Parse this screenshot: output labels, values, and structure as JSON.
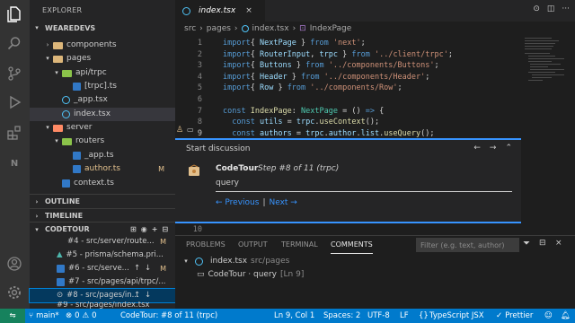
{
  "explorer": {
    "title": "EXPLORER",
    "workspace": "WEAREDEVS",
    "tree": [
      {
        "label": "components",
        "badge": ""
      },
      {
        "label": "pages",
        "badge": ""
      },
      {
        "label": "api/trpc",
        "badge": ""
      },
      {
        "label": "[trpc].ts",
        "badge": ""
      },
      {
        "label": "_app.tsx",
        "badge": ""
      },
      {
        "label": "index.tsx",
        "badge": ""
      },
      {
        "label": "server",
        "badge": ""
      },
      {
        "label": "routers",
        "badge": ""
      },
      {
        "label": "_app.ts",
        "badge": ""
      },
      {
        "label": "author.ts",
        "badge": "M"
      },
      {
        "label": "context.ts",
        "badge": ""
      }
    ],
    "outline": "OUTLINE",
    "timeline": "TIMELINE",
    "codetour": "CODETOUR"
  },
  "tour_steps": [
    {
      "label": "#4 - src/server/route...",
      "badge": "M"
    },
    {
      "label": "#5 - prisma/schema.pri...",
      "badge": ""
    },
    {
      "label": "#6 - src/serve...",
      "badge": "M"
    },
    {
      "label": "#7 - src/pages/api/trpc/...",
      "badge": ""
    },
    {
      "label": "#8 - src/pages/in...",
      "badge": ""
    },
    {
      "label": "#9 - src/pages/index.tsx",
      "badge": ""
    }
  ],
  "editor": {
    "tab_label": "index.tsx",
    "breadcrumb": [
      "src",
      "pages",
      "index.tsx",
      "IndexPage"
    ],
    "line_numbers": [
      "1",
      "2",
      "3",
      "4",
      "5",
      "6",
      "7",
      "8",
      "9"
    ],
    "line_10": "10",
    "code": [
      [
        [
          "kw",
          "import"
        ],
        [
          "",
          "{ "
        ],
        [
          "var",
          "NextPage"
        ],
        [
          "",
          " } "
        ],
        [
          "kw",
          "from"
        ],
        [
          "",
          " "
        ],
        [
          "str",
          "'next'"
        ],
        [
          "",
          ";"
        ]
      ],
      [
        [
          "kw",
          "import"
        ],
        [
          "",
          "{ "
        ],
        [
          "var",
          "RouterInput"
        ],
        [
          "",
          ", "
        ],
        [
          "var",
          "trpc"
        ],
        [
          "",
          " } "
        ],
        [
          "kw",
          "from"
        ],
        [
          "",
          " "
        ],
        [
          "str",
          "'../client/trpc'"
        ],
        [
          "",
          ";"
        ]
      ],
      [
        [
          "kw",
          "import"
        ],
        [
          "",
          "{ "
        ],
        [
          "var",
          "Buttons"
        ],
        [
          "",
          " } "
        ],
        [
          "kw",
          "from"
        ],
        [
          "",
          " "
        ],
        [
          "str",
          "'../components/Buttons'"
        ],
        [
          "",
          ";"
        ]
      ],
      [
        [
          "kw",
          "import"
        ],
        [
          "",
          "{ "
        ],
        [
          "var",
          "Header"
        ],
        [
          "",
          " } "
        ],
        [
          "kw",
          "from"
        ],
        [
          "",
          " "
        ],
        [
          "str",
          "'../components/Header'"
        ],
        [
          "",
          ";"
        ]
      ],
      [
        [
          "kw",
          "import"
        ],
        [
          "",
          "{ "
        ],
        [
          "var",
          "Row"
        ],
        [
          "",
          " } "
        ],
        [
          "kw",
          "from"
        ],
        [
          "",
          " "
        ],
        [
          "str",
          "'../components/Row'"
        ],
        [
          "",
          ";"
        ]
      ],
      [],
      [
        [
          "kw",
          "const"
        ],
        [
          "",
          " "
        ],
        [
          "fn",
          "IndexPage"
        ],
        [
          "",
          ": "
        ],
        [
          "ty",
          "NextPage"
        ],
        [
          "",
          " = () "
        ],
        [
          "kw",
          "=>"
        ],
        [
          "",
          " {"
        ]
      ],
      [
        [
          "",
          ""
        ],
        [
          "kw",
          "  const"
        ],
        [
          "",
          " "
        ],
        [
          "var",
          "utils"
        ],
        [
          "",
          " = "
        ],
        [
          "var",
          "trpc"
        ],
        [
          "",
          "."
        ],
        [
          "fn",
          "useContext"
        ],
        [
          "",
          "();"
        ]
      ],
      [
        [
          "",
          ""
        ],
        [
          "kw",
          "  const"
        ],
        [
          "",
          " "
        ],
        [
          "var",
          "authors"
        ],
        [
          "",
          " = "
        ],
        [
          "var",
          "trpc"
        ],
        [
          "",
          "."
        ],
        [
          "var",
          "author"
        ],
        [
          "",
          "."
        ],
        [
          "var",
          "list"
        ],
        [
          "",
          "."
        ],
        [
          "fn",
          "useQuery"
        ],
        [
          "",
          "();"
        ]
      ]
    ]
  },
  "comment": {
    "header": "Start discussion",
    "author": "CodeTour",
    "step": "Step #8 of 11 (trpc)",
    "body": "query",
    "previous": "← Previous",
    "separator": "|",
    "next": "Next →"
  },
  "panel": {
    "tabs": [
      "PROBLEMS",
      "OUTPUT",
      "TERMINAL",
      "COMMENTS"
    ],
    "filter_placeholder": "Filter (e.g. text, author)",
    "file": "index.tsx",
    "file_path": "src/pages",
    "comment_line": "CodeTour · query",
    "comment_ref": "[Ln 9]"
  },
  "status": {
    "branch": "main*",
    "errors": "0",
    "warnings": "0",
    "tour": "CodeTour: #8 of 11 (trpc)",
    "position": "Ln 9, Col 1",
    "spaces": "Spaces: 2",
    "encoding": "UTF-8",
    "eol": "LF",
    "language": "TypeScript JSX",
    "prettier": "Prettier"
  }
}
